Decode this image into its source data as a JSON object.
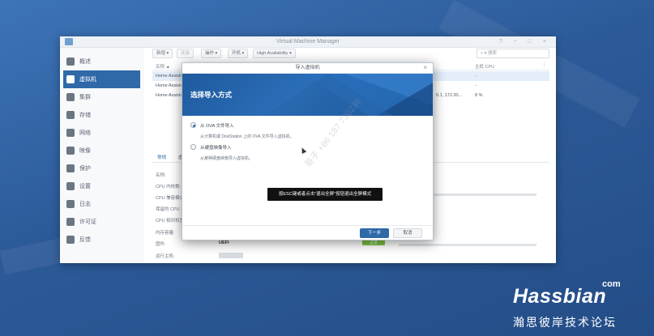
{
  "window": {
    "title": "Virtual Machine Manager",
    "controls": "? − □ ×"
  },
  "sidebar": {
    "items": [
      {
        "label": "概述",
        "icon": "overview-icon"
      },
      {
        "label": "虚拟机",
        "icon": "vm-icon",
        "active": true
      },
      {
        "label": "集群",
        "icon": "cluster-icon"
      },
      {
        "label": "存储",
        "icon": "storage-icon"
      },
      {
        "label": "网络",
        "icon": "network-icon"
      },
      {
        "label": "映像",
        "icon": "image-icon"
      },
      {
        "label": "保护",
        "icon": "protect-icon"
      },
      {
        "label": "设置",
        "icon": "settings-icon"
      },
      {
        "label": "日志",
        "icon": "log-icon"
      },
      {
        "label": "许可证",
        "icon": "license-icon"
      },
      {
        "label": "反馈",
        "icon": "feedback-icon"
      }
    ]
  },
  "toolbar": {
    "new": "新增 ▾",
    "connect": "连接",
    "action": "操作 ▾",
    "power": "开机 ▾",
    "ha": "High Availability ▾",
    "search_placeholder": "▾ 搜索"
  },
  "table": {
    "col_name": "名称 ▲",
    "col_cpu": "主机 CPU",
    "rows": [
      {
        "name": "Home Assista",
        "ip": "",
        "cpu": "-"
      },
      {
        "name": "Home Assista",
        "ip": "",
        "cpu": "-"
      },
      {
        "name": "Home Assista",
        "ip": "0.1, 172.30...",
        "cpu": "8 %"
      }
    ]
  },
  "details": {
    "tab_general": "常规",
    "tab_second": "虚",
    "labels": [
      "名称:",
      "CPU 内核数:",
      "CPU 兼容模式:",
      "保留的 CPU ...",
      "CPU 相对权重:",
      "内存容量:",
      "固件:",
      "运行主机:"
    ],
    "firmware": "UEFI",
    "badge": "正常"
  },
  "dialog": {
    "title": "导入虚拟机",
    "heading": "选择导入方式",
    "option1": "从 OVA 文件导入",
    "option1_desc": "从计算机或 DiskStation 上的 OVA 文件导入虚拟机。",
    "option2": "从硬盘映像导入",
    "option2_desc": "从某种硬盘映像导入虚拟机。",
    "next": "下一步",
    "cancel": "取消"
  },
  "toast": "按ESC键或者点击\"退出全屏\"按钮退出全屏模式",
  "watermark": "哥子 +86 187 730236",
  "brand": {
    "name": "Hassbian",
    "com": "com",
    "subtitle": "瀚思彼岸技术论坛"
  },
  "colors": {
    "accent": "#2f69a8",
    "desktop": "#2f5f9e",
    "banner": "#1f5a9e"
  }
}
